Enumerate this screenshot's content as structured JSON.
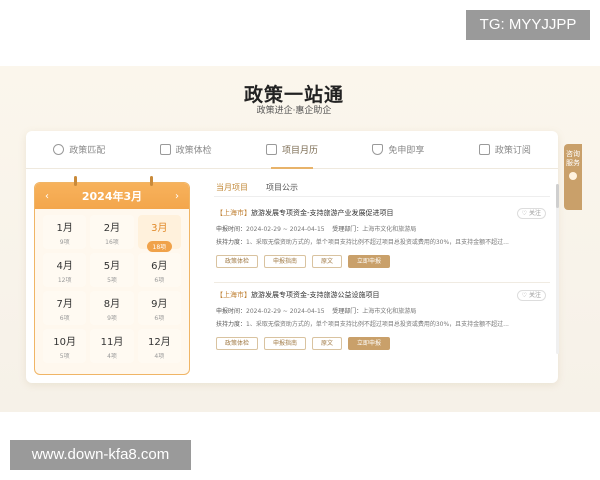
{
  "watermarks": {
    "top": "TG: MYYJJPP",
    "bottom": "www.down-kfa8.com"
  },
  "header": {
    "title": "政策一站通",
    "subtitle": "政策进企·惠企助企"
  },
  "tabs": [
    {
      "label": "政策匹配",
      "icon": "target-icon"
    },
    {
      "label": "政策体检",
      "icon": "medical-kit-icon"
    },
    {
      "label": "项目月历",
      "icon": "calendar-icon",
      "active": true
    },
    {
      "label": "免申即享",
      "icon": "shield-icon"
    },
    {
      "label": "政策订阅",
      "icon": "document-icon"
    }
  ],
  "side_tab": {
    "label": "咨询服务"
  },
  "calendar": {
    "title": "2024年3月",
    "prev": "‹",
    "next": "›",
    "months": [
      {
        "month": "1月",
        "count": "9项"
      },
      {
        "month": "2月",
        "count": "16项"
      },
      {
        "month": "3月",
        "count": "18项",
        "active": true
      },
      {
        "month": "4月",
        "count": "12项"
      },
      {
        "month": "5月",
        "count": "5项"
      },
      {
        "month": "6月",
        "count": "6项"
      },
      {
        "month": "7月",
        "count": "6项"
      },
      {
        "month": "8月",
        "count": "9项"
      },
      {
        "month": "9月",
        "count": "6项"
      },
      {
        "month": "10月",
        "count": "5项"
      },
      {
        "month": "11月",
        "count": "4项"
      },
      {
        "month": "12月",
        "count": "4项"
      }
    ]
  },
  "list": {
    "subtabs": [
      "当月项目",
      "项目公示"
    ],
    "items": [
      {
        "city": "【上海市】",
        "title": "旅游发展专项资金-支持旅游产业发展促进项目",
        "favorite": "关注",
        "period_label": "申报时间：",
        "period": "2024-02-29 ~ 2024-04-15",
        "dept_label": "受理部门：",
        "dept": "上海市文化和旅游局",
        "support_label": "扶持力度：",
        "support": "1、采取无偿资助方式的，单个项目支持比例不超过项目总投资或费用的30%，且支持金额不超过...",
        "buttons": [
          "政策体检",
          "申报指南",
          "原文",
          "立即申报"
        ]
      },
      {
        "city": "【上海市】",
        "title": "旅游发展专项资金-支持旅游公益设施项目",
        "favorite": "关注",
        "period_label": "申报时间：",
        "period": "2024-02-29 ~ 2024-04-15",
        "dept_label": "受理部门：",
        "dept": "上海市文化和旅游局",
        "support_label": "扶持力度：",
        "support": "1、采取无偿资助方式的，单个项目支持比例不超过项目总投资或费用的30%，且支持金额不超过...",
        "buttons": [
          "政策体检",
          "申报指南",
          "原文",
          "立即申报"
        ]
      }
    ]
  }
}
